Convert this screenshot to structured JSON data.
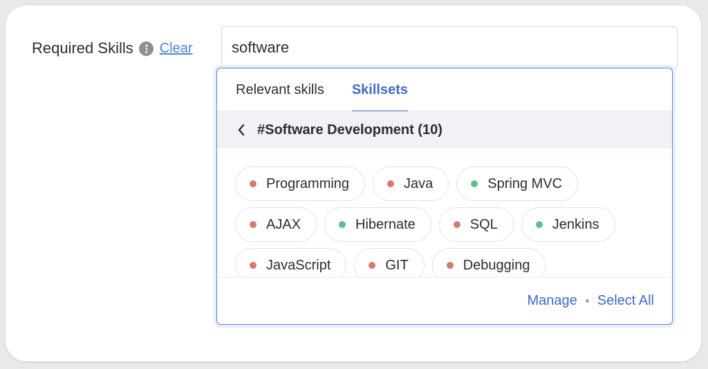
{
  "field": {
    "label": "Required Skills",
    "clear_label": "Clear",
    "info_icon": "info-icon"
  },
  "search": {
    "value": "software"
  },
  "dropdown": {
    "tabs": [
      {
        "label": "Relevant skills",
        "active": false
      },
      {
        "label": "Skillsets",
        "active": true
      }
    ],
    "skillset_title": "#Software Development (10)",
    "back_icon": "chevron-left-icon",
    "chips": [
      {
        "label": "Programming",
        "status": "red"
      },
      {
        "label": "Java",
        "status": "red"
      },
      {
        "label": "Spring MVC",
        "status": "green"
      },
      {
        "label": "AJAX",
        "status": "red"
      },
      {
        "label": "Hibernate",
        "status": "green"
      },
      {
        "label": "SQL",
        "status": "red"
      },
      {
        "label": "Jenkins",
        "status": "green"
      },
      {
        "label": "JavaScript",
        "status": "red"
      },
      {
        "label": "GIT",
        "status": "red"
      },
      {
        "label": "Debugging",
        "status": "red"
      }
    ],
    "footer": {
      "manage_label": "Manage",
      "select_all_label": "Select All"
    }
  },
  "colors": {
    "red": "#d9786f",
    "green": "#5fbf88",
    "accent": "#3f6ac9",
    "link": "#4a86d8"
  }
}
